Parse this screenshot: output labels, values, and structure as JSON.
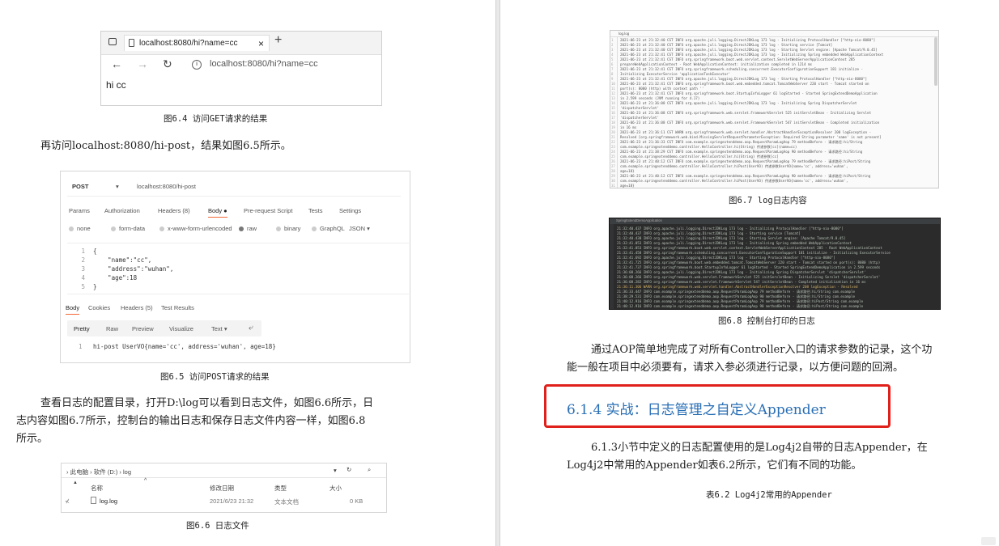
{
  "fig64": {
    "tab_title": "localhost:8080/hi?name=cc",
    "tab_close": "×",
    "new_tab": "+",
    "address": "localhost:8080/hi?name=cc",
    "content": "hi cc",
    "caption": "图6.4  访问GET请求的结果"
  },
  "para1": "再访问localhost:8080/hi-post，结果如图6.5所示。",
  "fig65": {
    "method": "POST",
    "url": "localhost:8080/hi-post",
    "tabs": [
      "Params",
      "Authorization",
      "Headers (8)",
      "Body ●",
      "Pre-request Script",
      "Tests",
      "Settings"
    ],
    "body_types": [
      "none",
      "form-data",
      "x-www-form-urlencoded",
      "raw",
      "binary",
      "GraphQL",
      "JSON ▾"
    ],
    "line_numbers": [
      "1",
      "2",
      "3",
      "4",
      "5"
    ],
    "code_lines": [
      "{",
      "    \"name\":\"cc\",",
      "    \"address\":\"wuhan\",",
      "    \"age\":18",
      "}"
    ],
    "resp_tabs": [
      "Body",
      "Cookies",
      "Headers (5)",
      "Test Results"
    ],
    "resp_views": [
      "Pretty",
      "Raw",
      "Preview",
      "Visualize",
      "Text ▾"
    ],
    "resp_line_no": "1",
    "resp_line": "hi-post UserVO{name='cc', address='wuhan', age=18}",
    "caption": "图6.5  访问POST请求的结果"
  },
  "para2_lines": [
    "查看日志的配置目录，打开D:\\log可以看到日志文件，如图6.6所示，日",
    "志内容如图6.7所示，控制台的输出日志和保存日志文件内容一样，如图6.8",
    "所示。"
  ],
  "fig66": {
    "breadcrumb": "› 此电脑 › 软件 (D:) › log",
    "col_name": "名称",
    "col_date": "修改日期",
    "col_type": "类型",
    "col_size": "大小",
    "file_name": "log.log",
    "file_date": "2021/6/23 21:32",
    "file_type": "文本文档",
    "file_size": "0 KB",
    "caption": "图6.6  日志文件"
  },
  "fig67": {
    "tab_label": "log.log",
    "lines": [
      "2021-06-23 at 21:32:40 CST INFO  org.apache.juli.logging.DirectJDKLog 173 log - Initializing ProtocolHandler [\"http-nio-8080\"]",
      "2021-06-23 at 21:32:40 CST INFO  org.apache.juli.logging.DirectJDKLog 173 log - Starting service [Tomcat]",
      "2021-06-23 at 21:32:40 CST INFO  org.apache.juli.logging.DirectJDKLog 173 log - Starting Servlet engine: [Apache Tomcat/9.0.45]",
      "2021-06-23 at 21:32:41 CST INFO  org.apache.juli.logging.DirectJDKLog 173 log - Initializing Spring embedded WebApplicationContext",
      "2021-06-23 at 21:32:41 CST INFO  org.springframework.boot.web.servlet.context.ServletWebServerApplicationContext 285",
      "prepareWebApplicationContext - Root WebApplicationContext: initialization completed in 1214 ms",
      "2021-06-23 at 21:32:41 CST INFO  org.springframework.scheduling.concurrent.ExecutorConfigurationSupport 181 initialize -",
      "Initializing ExecutorService 'applicationTaskExecutor'",
      "2021-06-23 at 21:32:41 CST INFO  org.apache.juli.logging.DirectJDKLog 173 log - Starting ProtocolHandler [\"http-nio-8080\"]",
      "2021-06-23 at 21:32:41 CST INFO  org.springframework.boot.web.embedded.tomcat.TomcatWebServer 220 start - Tomcat started on",
      "port(s): 8080 (http) with context path ''",
      "2021-06-23 at 21:32:41 CST INFO  org.springframework.boot.StartupInfoLogger 61 logStarted - Started SpringExtendDemoApplication",
      "in 2.599 seconds (JVM running for 4.17)",
      "2021-06-23 at 21:36:08 CST INFO  org.apache.juli.logging.DirectJDKLog 173 log - Initializing Spring DispatcherServlet",
      "'dispatcherServlet'",
      "2021-06-23 at 21:36:08 CST INFO  org.springframework.web.servlet.FrameworkServlet 525 initServletBean - Initializing Servlet",
      "'dispatcherServlet'",
      "2021-06-23 at 21:36:08 CST INFO  org.springframework.web.servlet.FrameworkServlet 547 initServletBean - Completed initialization",
      "in 16 ms",
      "2021-06-23 at 21:36:11 CST WARN  org.springframework.web.servlet.handler.AbstractHandlerExceptionResolver 208 logException -",
      "Resolved [org.springframework.web.bind.MissingServletRequestParameterException: Required String parameter 'name' is not present]",
      "2021-06-23 at 21:36:33 CST INFO  com.example.springextenddemo.aop.RequestParamLogAop 79 methodBefore - 请求路径:hi/String",
      "com.example.springextenddemo.controller.HelloController.hi(String) 传递参数[cc](name=cc)",
      "2021-06-23 at 21:38:29 CST INFO  com.example.springextenddemo.aop.RequestParamLogAop 90 methodBefore - 请求路径:hi/String",
      "com.example.springextenddemo.controller.HelloController.hi(String) 传递参数[cc]",
      "2021-06-23 at 21:40:12 CST INFO  com.example.springextenddemo.aop.RequestParamLogAop 79 methodBefore - 请求路径:hiPost/String",
      "com.example.springextenddemo.controller.HelloController.hiPost(UserVO) 传递参数UserVO{name='cc', address='wuhan',",
      "age=18}",
      "2021-06-23 at 21:40:12 CST INFO  com.example.springextenddemo.aop.RequestParamLogAop 90 methodBefore - 请求路径:hiPost/String",
      "com.example.springextenddemo.controller.HelloController.hiPost(UserVO) 传递参数UserVO{name='cc', address='wuhan',",
      "age=18}"
    ],
    "caption": "图6.7  log日志内容"
  },
  "fig68": {
    "title": "SpringExtendDemoApplication",
    "lines": [
      "21:32:40.437 INFO  org.apache.juli.logging.DirectJDKLog 173 log - Initializing ProtocolHandler [\"http-nio-8080\"]",
      "21:32:40.437 INFO  org.apache.juli.logging.DirectJDKLog 173 log - Starting service [Tomcat]",
      "21:32:40.438 INFO  org.apache.juli.logging.DirectJDKLog 173 log - Starting Servlet engine: [Apache Tomcat/9.0.45]",
      "21:32:41.053 INFO  org.apache.juli.logging.DirectJDKLog 173 log - Initializing Spring embedded WebApplicationContext",
      "21:32:41.053 INFO  org.springframework.boot.web.servlet.context.ServletWebServerApplicationContext 285 - Root WebApplicationContext",
      "21:32:41.458 INFO  org.springframework.scheduling.concurrent.ExecutorConfigurationSupport 181 initialize - Initializing ExecutorService",
      "21:32:41.692 INFO  org.apache.juli.logging.DirectJDKLog 173 log - Starting ProtocolHandler [\"http-nio-8080\"]",
      "21:32:41.725 INFO  org.springframework.boot.web.embedded.tomcat.TomcatWebServer 220 start - Tomcat started on port(s): 8080 (http)",
      "21:32:41.737 INFO  org.springframework.boot.StartupInfoLogger 61 logStarted - Started SpringExtendDemoApplication in 2.599 seconds",
      "21:36:08.266 INFO  org.apache.juli.logging.DirectJDKLog 173 log - Initializing Spring DispatcherServlet 'dispatcherServlet'",
      "21:36:08.266 INFO  org.springframework.web.servlet.FrameworkServlet 525 initServletBean - Initializing Servlet 'dispatcherServlet'",
      "21:36:08.282 INFO  org.springframework.web.servlet.FrameworkServlet 547 initServletBean - Completed initialization in 16 ms",
      "21:36:11.306 WARN  org.springframework.web.servlet.handler.AbstractHandlerExceptionResolver 208 logException - Resolved",
      "21:36:33.447 INFO  com.example.springextenddemo.aop.RequestParamLogAop 79 methodBefore - 请求路径:hi/String com.example",
      "21:38:29.531 INFO  com.example.springextenddemo.aop.RequestParamLogAop 90 methodBefore - 请求路径:hi/String com.example",
      "21:40:12.916 INFO  com.example.springextenddemo.aop.RequestParamLogAop 79 methodBefore - 请求路径:hiPost/String com.example",
      "21:40:12.916 INFO  com.example.springextenddemo.aop.RequestParamLogAop 90 methodBefore - 请求路径:hiPost/String com.example"
    ],
    "caption": "图6.8  控制台打印的日志"
  },
  "para3_lines": [
    "通过AOP简单地完成了对所有Controller入口的请求参数的记录，这个功",
    "能一般在项目中必须要有，请求入参必须进行记录，以方便问题的回溯。"
  ],
  "heading": "6.1.4  实战：日志管理之自定义Appender",
  "para4_lines": [
    "6.1.3小节中定义的日志配置使用的是Log4j2自带的日志Appender，在",
    "Log4j2中常用的Appender如表6.2所示，它们有不同的功能。"
  ],
  "table_caption": "表6.2  Log4j2常用的Appender",
  "colors": {
    "heading": "#2a6fb5",
    "highlight_box": "#e0201b",
    "console_bg": "#2b2b2b"
  }
}
